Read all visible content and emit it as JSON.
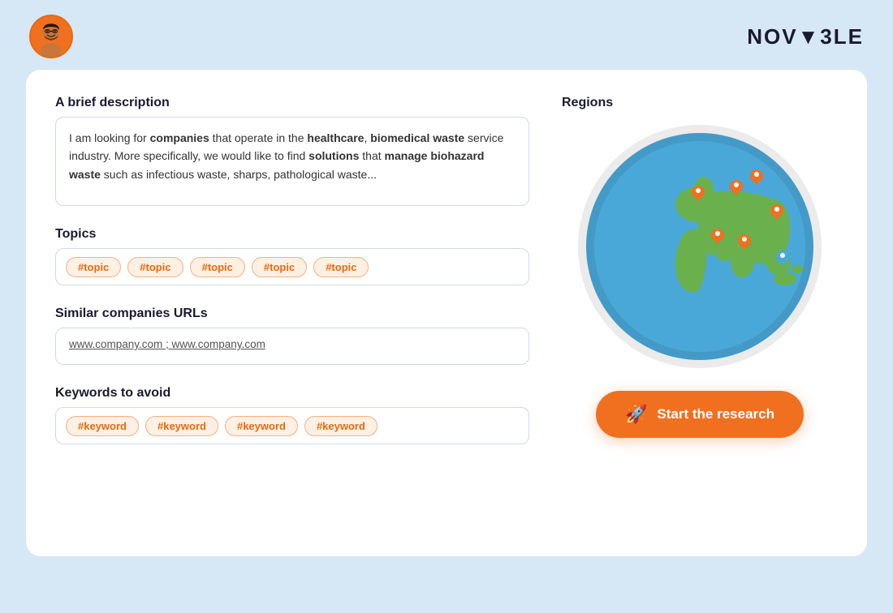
{
  "header": {
    "logo": "NOV▲3LE"
  },
  "description": {
    "label": "A brief description",
    "text_plain": "I am looking for companies that operate in the healthcare, biomedical waste service industry. More specifically, we would like to find solutions that manage biohazard waste such as infectious waste, sharps, pathological waste...",
    "bold_words": [
      "companies",
      "healthcare",
      "biomedical waste",
      "solutions",
      "manage biohazard waste"
    ]
  },
  "topics": {
    "label": "Topics",
    "tags": [
      "#topic",
      "#topic",
      "#topic",
      "#topic",
      "#topic"
    ]
  },
  "similar_urls": {
    "label": "Similar companies URLs",
    "placeholder": "www.company.com ; www.company.com",
    "value": "www.company.com ; www.company.com"
  },
  "keywords": {
    "label": "Keywords to avoid",
    "tags": [
      "#keyword",
      "#keyword",
      "#keyword",
      "#keyword"
    ]
  },
  "regions": {
    "label": "Regions"
  },
  "start_button": {
    "label": "Start the research"
  }
}
